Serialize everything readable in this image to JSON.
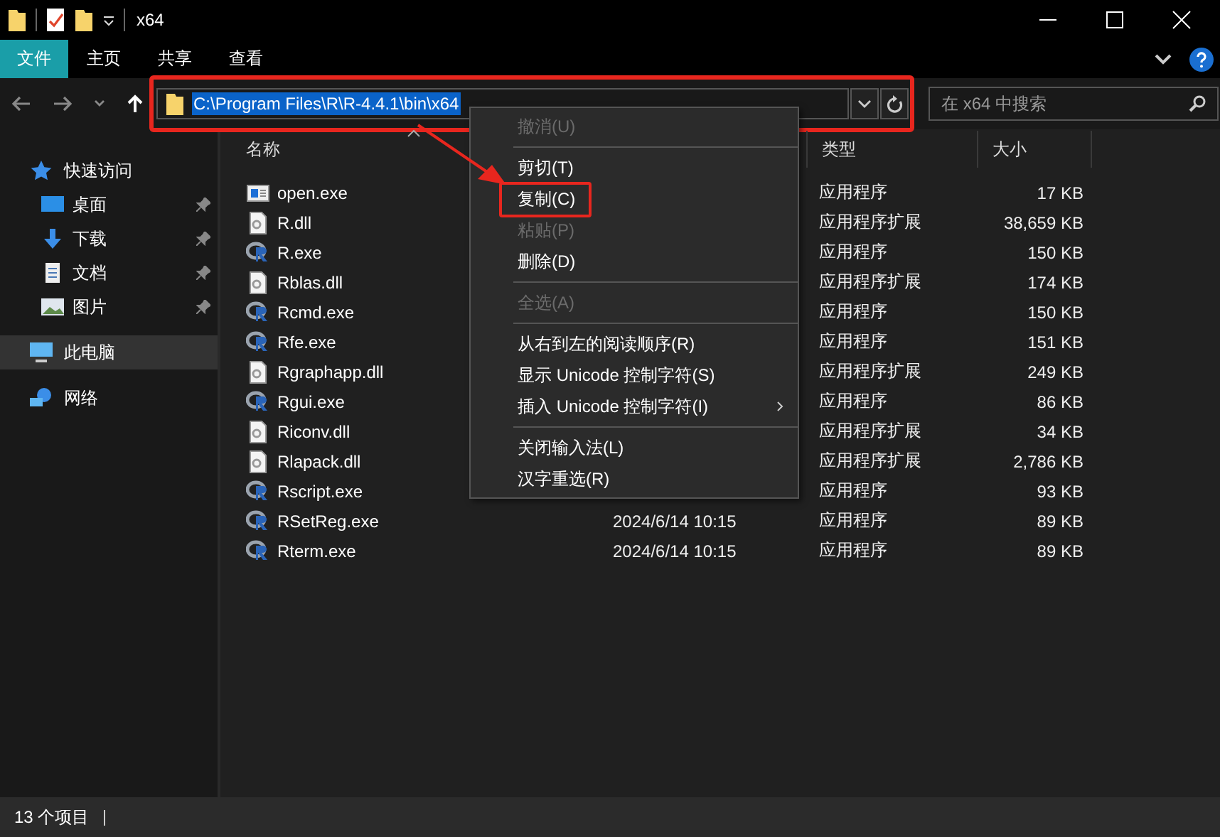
{
  "window": {
    "title": "x64"
  },
  "ribbon": {
    "tabs": [
      {
        "label": "文件",
        "selected": true
      },
      {
        "label": "主页",
        "selected": false
      },
      {
        "label": "共享",
        "selected": false
      },
      {
        "label": "查看",
        "selected": false
      }
    ]
  },
  "address": {
    "path": "C:\\Program Files\\R\\R-4.4.1\\bin\\x64",
    "selected": true,
    "annotated": true
  },
  "search": {
    "placeholder": "在 x64 中搜索"
  },
  "sidebar": {
    "items": [
      {
        "label": "快速访问",
        "kind": "star",
        "selected": false,
        "children": [
          {
            "label": "桌面",
            "kind": "desktop",
            "pinned": true,
            "selected": false
          },
          {
            "label": "下载",
            "kind": "download",
            "pinned": true,
            "selected": false
          },
          {
            "label": "文档",
            "kind": "document",
            "pinned": true,
            "selected": false
          },
          {
            "label": "图片",
            "kind": "pictures",
            "pinned": true,
            "selected": false
          }
        ]
      },
      {
        "label": "此电脑",
        "kind": "computer",
        "selected": true
      },
      {
        "label": "网络",
        "kind": "network",
        "selected": false
      }
    ]
  },
  "table": {
    "columns": [
      {
        "label": "名称"
      },
      {},
      {
        "label": "类型"
      },
      {
        "label": "大小"
      }
    ],
    "rows": [
      {
        "kind": "app",
        "name": "open.exe",
        "type": "应用程序",
        "size": "17 KB"
      },
      {
        "kind": "dll",
        "name": "R.dll",
        "type": "应用程序扩展",
        "size": "38,659 KB"
      },
      {
        "kind": "r",
        "name": "R.exe",
        "type": "应用程序",
        "size": "150 KB"
      },
      {
        "kind": "dll",
        "name": "Rblas.dll",
        "type": "应用程序扩展",
        "size": "174 KB"
      },
      {
        "kind": "r",
        "name": "Rcmd.exe",
        "type": "应用程序",
        "size": "150 KB"
      },
      {
        "kind": "r",
        "name": "Rfe.exe",
        "type": "应用程序",
        "size": "151 KB"
      },
      {
        "kind": "dll",
        "name": "Rgraphapp.dll",
        "type": "应用程序扩展",
        "size": "249 KB"
      },
      {
        "kind": "r",
        "name": "Rgui.exe",
        "type": "应用程序",
        "size": "86 KB"
      },
      {
        "kind": "dll",
        "name": "Riconv.dll",
        "type": "应用程序扩展",
        "size": "34 KB"
      },
      {
        "kind": "dll",
        "name": "Rlapack.dll",
        "type": "应用程序扩展",
        "size": "2,786 KB"
      },
      {
        "kind": "r",
        "name": "Rscript.exe",
        "type": "应用程序",
        "size": "93 KB"
      },
      {
        "kind": "r",
        "name": "RSetReg.exe",
        "modified": "2024/6/14 10:15",
        "type": "应用程序",
        "size": "89 KB"
      },
      {
        "kind": "r",
        "name": "Rterm.exe",
        "modified": "2024/6/14 10:15",
        "type": "应用程序",
        "size": "89 KB"
      }
    ]
  },
  "context_menu": {
    "items": [
      {
        "kind": "item",
        "label": "撤消(U)",
        "disabled": true,
        "annotated": false
      },
      {
        "kind": "separator"
      },
      {
        "kind": "item",
        "label": "剪切(T)",
        "disabled": false,
        "annotated": false
      },
      {
        "kind": "item",
        "label": "复制(C)",
        "disabled": false,
        "annotated": true
      },
      {
        "kind": "item",
        "label": "粘贴(P)",
        "disabled": true,
        "annotated": false
      },
      {
        "kind": "item",
        "label": "删除(D)",
        "disabled": false,
        "annotated": false
      },
      {
        "kind": "separator"
      },
      {
        "kind": "item",
        "label": "全选(A)",
        "disabled": true,
        "annotated": false
      },
      {
        "kind": "separator"
      },
      {
        "kind": "item",
        "label": "从右到左的阅读顺序(R)",
        "disabled": false,
        "annotated": false
      },
      {
        "kind": "item",
        "label": "显示 Unicode 控制字符(S)",
        "disabled": false,
        "annotated": false
      },
      {
        "kind": "submenu",
        "label": "插入 Unicode 控制字符(I)",
        "disabled": false,
        "annotated": false
      },
      {
        "kind": "separator"
      },
      {
        "kind": "item",
        "label": "关闭输入法(L)",
        "disabled": false,
        "annotated": false
      },
      {
        "kind": "item",
        "label": "汉字重选(R)",
        "disabled": false,
        "annotated": false
      }
    ]
  },
  "status_bar": {
    "count": "13 个项目"
  }
}
